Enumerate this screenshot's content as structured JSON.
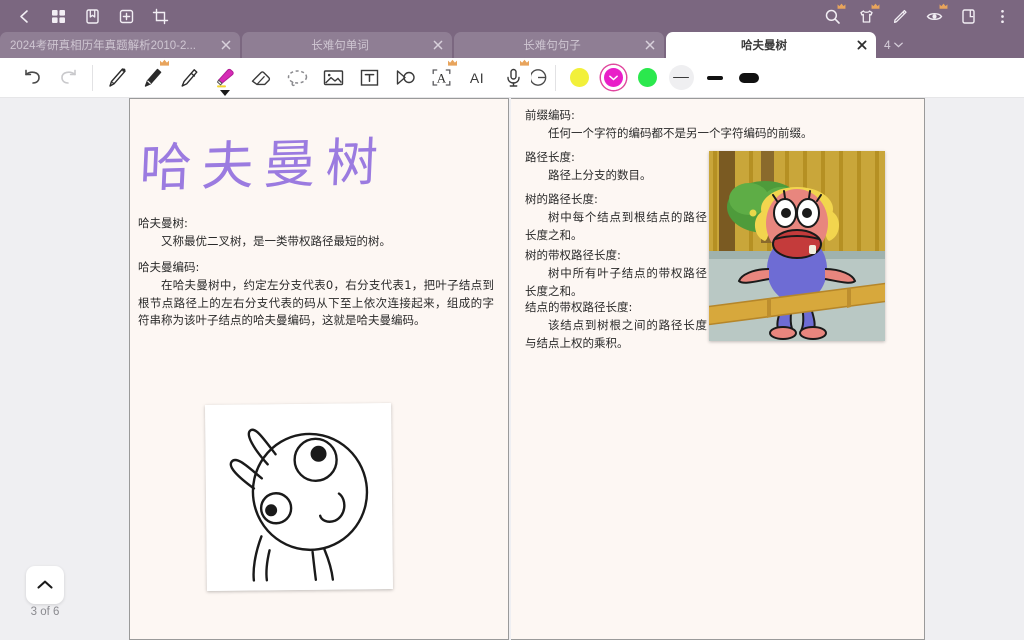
{
  "topbar": {
    "background_color": "#7B6780",
    "left_icons": [
      {
        "name": "back-icon",
        "label": "Back"
      },
      {
        "name": "grid-view-icon",
        "label": "Grid view"
      },
      {
        "name": "bookmark-icon",
        "label": "Bookmark"
      },
      {
        "name": "add-page-icon",
        "label": "Add"
      },
      {
        "name": "crop-icon",
        "label": "Crop"
      }
    ],
    "right_icons": [
      {
        "name": "search-icon",
        "label": "Search",
        "premium": true
      },
      {
        "name": "theme-shirt-icon",
        "label": "Theme",
        "premium": true
      },
      {
        "name": "annotate-pen-icon",
        "label": "Annotate",
        "premium": false
      },
      {
        "name": "eye-read-icon",
        "label": "Read mode",
        "premium": true
      },
      {
        "name": "page-layout-icon",
        "label": "Layout",
        "premium": false
      },
      {
        "name": "more-menu-icon",
        "label": "More",
        "premium": false
      }
    ]
  },
  "tabs": {
    "items": [
      {
        "label": "2024考研真相历年真题解析2010-2...",
        "active": false
      },
      {
        "label": "长难句单词",
        "active": false
      },
      {
        "label": "长难句句子",
        "active": false
      },
      {
        "label": "哈夫曼树",
        "active": true
      }
    ],
    "close_label": "×",
    "count": "4"
  },
  "toolbar": {
    "tools": [
      {
        "name": "undo-icon",
        "label": "Undo",
        "premium": false,
        "selected": false
      },
      {
        "name": "redo-icon",
        "label": "Redo",
        "premium": false,
        "selected": false
      },
      {
        "name": "pen-icon",
        "label": "Pen",
        "premium": false,
        "selected": false
      },
      {
        "name": "pencil-icon",
        "label": "Pencil",
        "premium": true,
        "selected": false
      },
      {
        "name": "fountain-pen-icon",
        "label": "Fountain pen",
        "premium": false,
        "selected": false
      },
      {
        "name": "highlighter-icon",
        "label": "Highlighter",
        "premium": false,
        "selected": true
      },
      {
        "name": "eraser-icon",
        "label": "Eraser",
        "premium": false,
        "selected": false
      },
      {
        "name": "lasso-select-icon",
        "label": "Lasso select",
        "premium": false,
        "selected": false
      },
      {
        "name": "insert-image-icon",
        "label": "Insert image",
        "premium": false,
        "selected": false
      },
      {
        "name": "text-box-icon",
        "label": "Text box",
        "premium": false,
        "selected": false
      },
      {
        "name": "shape-icon",
        "label": "Shape",
        "premium": false,
        "selected": false
      },
      {
        "name": "smart-text-icon",
        "label": "Smart text",
        "premium": true,
        "selected": false
      },
      {
        "name": "ai-icon",
        "label": "AI",
        "premium": false,
        "selected": false
      },
      {
        "name": "microphone-icon",
        "label": "Voice note",
        "premium": true,
        "selected": false
      },
      {
        "name": "partial-circle-icon",
        "label": "More tools",
        "premium": false,
        "selected": false
      }
    ],
    "ai_label": "AI",
    "colors": [
      {
        "name": "color-yellow",
        "hex": "#F2F03A",
        "selected": false
      },
      {
        "name": "color-magenta",
        "hex": "#E91EC8",
        "selected": true
      },
      {
        "name": "color-green",
        "hex": "#2BE84D",
        "selected": false
      }
    ],
    "strokes": [
      {
        "name": "stroke-thin",
        "label": "Thin",
        "selected": true
      },
      {
        "name": "stroke-medium",
        "label": "Medium",
        "selected": false
      },
      {
        "name": "stroke-thick",
        "label": "Thick",
        "selected": false
      }
    ]
  },
  "page": {
    "background_color": "#FDF7F3",
    "handwritten_title": "哈夫曼树",
    "handwritten_title_color": "#9B7BE0",
    "left_column": [
      {
        "heading": "哈夫曼树:",
        "body": "又称最优二叉树，是一类带权路径最短的树。"
      },
      {
        "heading": "哈夫曼编码:",
        "body": "在哈夫曼树中，约定左分支代表0，右分支代表1，把叶子结点到根节点路径上的左右分支代表的码从下至上依次连接起来，组成的字符串称为该叶子结点的哈夫曼编码，这就是哈夫曼编码。"
      }
    ],
    "right_column": [
      {
        "heading": "前缀编码:",
        "body": "任何一个字符的编码都不是另一个字符编码的前缀。"
      },
      {
        "heading": "路径长度:",
        "body": "路径上分支的数目。"
      },
      {
        "heading": "树的路径长度:",
        "body": "树中每个结点到根结点的路径长度之和。"
      },
      {
        "heading": "树的带权路径长度:",
        "body": "树中所有叶子结点的带权路径长度之和。"
      },
      {
        "heading": "结点的带权路径长度:",
        "body": "该结点到树根之间的路径长度与结点上权的乘积。"
      }
    ],
    "images": [
      {
        "name": "sketch-image-pig-outline",
        "alt": "Hand-drawn cartoon face line sketch"
      },
      {
        "name": "photo-image-cartoon-character",
        "alt": "Cartoon character screenshot"
      }
    ]
  },
  "page_nav": {
    "up_icon": "chevron-up-icon",
    "label": "3 of 6"
  }
}
